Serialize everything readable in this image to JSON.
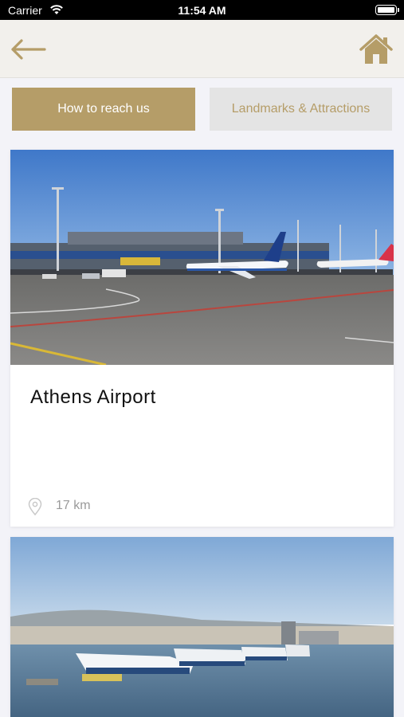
{
  "status_bar": {
    "carrier": "Carrier",
    "time": "11:54 AM"
  },
  "colors": {
    "accent": "#b59d68",
    "inactive_tab_bg": "#e4e4e4",
    "nav_bg": "#f2f0ec"
  },
  "tabs": [
    {
      "label": "How to reach us",
      "active": true
    },
    {
      "label": "Landmarks & Attractions",
      "active": false
    }
  ],
  "cards": [
    {
      "title": "Athens Airport",
      "distance": "17 km",
      "image": "airport-apron-photo"
    },
    {
      "title": "",
      "distance": "",
      "image": "port-ferries-photo"
    }
  ]
}
